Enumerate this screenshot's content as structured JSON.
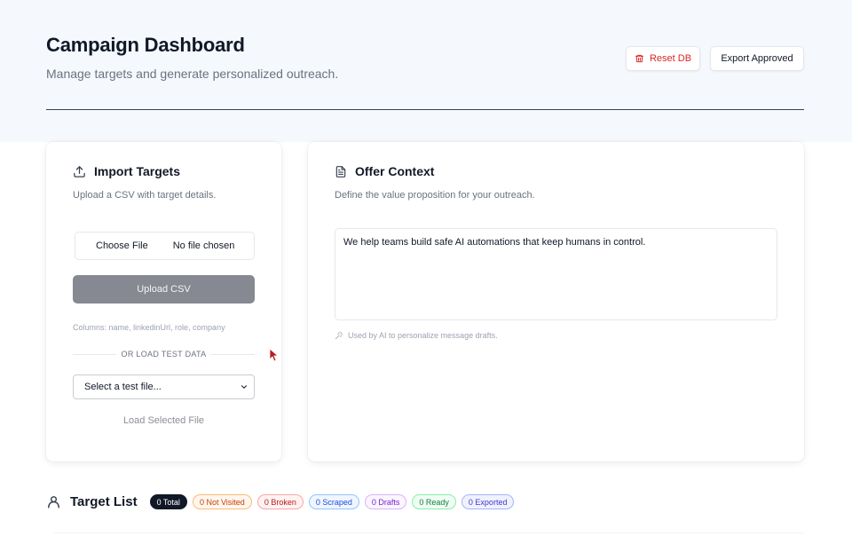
{
  "header": {
    "title": "Campaign Dashboard",
    "subtitle": "Manage targets and generate personalized outreach.",
    "reset_label": "Reset DB",
    "export_label": "Export Approved"
  },
  "import_card": {
    "title": "Import Targets",
    "description": "Upload a CSV with target details.",
    "choose_file_label": "Choose File",
    "file_status": "No file chosen",
    "upload_label": "Upload CSV",
    "columns_hint": "Columns: name, linkedinUrl, role, company",
    "or_label": "OR LOAD TEST DATA",
    "select_value": "Select a test file...",
    "load_label": "Load Selected File"
  },
  "offer_card": {
    "title": "Offer Context",
    "description": "Define the value proposition for your outreach.",
    "textarea_value": "We help teams build safe AI automations that keep humans in control.",
    "hint": "Used by AI to personalize message drafts."
  },
  "target_list": {
    "title": "Target List",
    "badges": [
      {
        "label": "0 Total",
        "color": "#ffffff",
        "bg": "#111827",
        "border": "#111827"
      },
      {
        "label": "0 Not Visited",
        "color": "#c2410c",
        "bg": "#fff7ed",
        "border": "#fdba74"
      },
      {
        "label": "0 Broken",
        "color": "#b91c1c",
        "bg": "#fef2f2",
        "border": "#fca5a5"
      },
      {
        "label": "0 Scraped",
        "color": "#1d4ed8",
        "bg": "#eff6ff",
        "border": "#93c5fd"
      },
      {
        "label": "0 Drafts",
        "color": "#7e22ce",
        "bg": "#faf5ff",
        "border": "#d8b4fe"
      },
      {
        "label": "0 Ready",
        "color": "#15803d",
        "bg": "#f0fdf4",
        "border": "#86efac"
      },
      {
        "label": "0 Exported",
        "color": "#4338ca",
        "bg": "#eef2ff",
        "border": "#a5b4fc"
      }
    ]
  },
  "colors": {
    "accent_danger": "#dc2626",
    "upload_button": "#868991",
    "background_band": "#f5f8fc"
  },
  "icons": {
    "reset": "trash-icon",
    "import": "upload-icon",
    "offer": "document-icon",
    "hint": "magic-wand-icon",
    "target": "user-icon",
    "select": "chevron-down-icon"
  }
}
